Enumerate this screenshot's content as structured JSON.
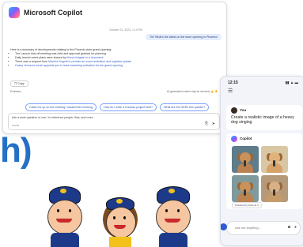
{
  "app": {
    "title": "Microsoft Copilot"
  },
  "conversation": {
    "timestamp": "October 23, 2023, 1:19 PM",
    "user_message": "Tiri! What's the latest on the store opening in Phoenix!",
    "response_intro": "Here is a summary of developments relating to the Phoenix store grand opening:",
    "bullets": [
      {
        "text": "The Launch kick-off meeting was held and approval granted for planning",
        "link": ""
      },
      {
        "text": "Daily launch event plans were shared by ",
        "link": "Mona Holgate in a document"
      },
      {
        "text": "There was a request from ",
        "link": "Maurice Anguiti to provide an event activation and logistics update"
      },
      {
        "text": "",
        "link": "Casey Jensen's email appoints you to lead marketing activation for the grand opening"
      }
    ],
    "copy_label": "Copy",
    "footer_left": "Endnotes",
    "footer_right": "AI-generated content may be incorrect"
  },
  "suggestions": [
    "Catch me up on the meeting I missed this morning",
    "How do I write a Contoso project brief?",
    "What are the OKRs this quarter?"
  ],
  "input": {
    "placeholder": "Ask a work question or use / to reference people, files, and more",
    "counter": "0/2000"
  },
  "headline_fragment": "h)",
  "phone": {
    "time": "12:15",
    "status": "▮▮ ▲ ▬",
    "menu_icon": "menu-icon",
    "user_name": "You",
    "user_message": "Create a realistic image of a heavy dog singing",
    "bot_name": "Copilot",
    "powered_by": "Powered by DALL-E 3",
    "input_placeholder": "Ask me anything..."
  },
  "colors": {
    "accent": "#2470c7",
    "suggestion_border": "#7aa0ff",
    "hat": "#1d3a8a",
    "badge": "#f2c21b"
  }
}
